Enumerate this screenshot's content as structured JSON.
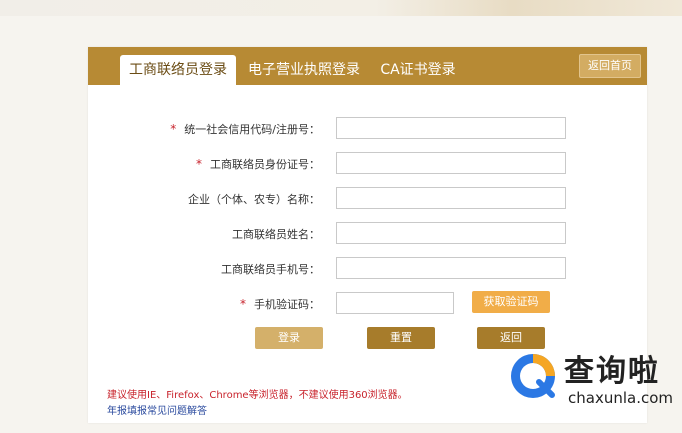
{
  "tabs": [
    {
      "label": "工商联络员登录"
    },
    {
      "label": "电子营业执照登录"
    },
    {
      "label": "CA证书登录"
    }
  ],
  "home_button": "返回首页",
  "form": {
    "required_mark": "*",
    "fields": [
      {
        "label": "统一社会信用代码/注册号：",
        "required": true,
        "value": ""
      },
      {
        "label": "工商联络员身份证号：",
        "required": true,
        "value": ""
      },
      {
        "label": "企业（个体、农专）名称：",
        "required": false,
        "value": ""
      },
      {
        "label": "工商联络员姓名：",
        "required": false,
        "value": ""
      },
      {
        "label": "工商联络员手机号：",
        "required": false,
        "value": ""
      },
      {
        "label": "手机验证码：",
        "required": true,
        "value": ""
      }
    ],
    "get_code_button": "获取验证码"
  },
  "actions": {
    "login": "登录",
    "reset": "重置",
    "back": "返回"
  },
  "notice": "建议使用IE、Firefox、Chrome等浏览器，不建议使用360浏览器。",
  "faq_link": "年报填报常见问题解答",
  "watermark": {
    "title": "查询啦",
    "domain": "chaxunla.com"
  },
  "colors": {
    "brand_gold": "#b78a34",
    "required_red": "#c8232c",
    "code_button_orange": "#f1ad48",
    "link_blue": "#2a4a9e"
  }
}
